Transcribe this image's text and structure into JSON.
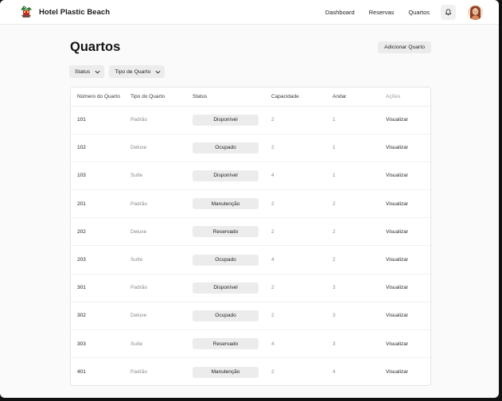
{
  "app": {
    "name": "Hotel Plastic Beach",
    "nav": [
      {
        "id": "dashboard",
        "label": "Dashboard"
      },
      {
        "id": "reservas",
        "label": "Reservas"
      },
      {
        "id": "quartos",
        "label": "Quartos"
      }
    ]
  },
  "page": {
    "title": "Quartos",
    "add_button": "Adicionar Quarto"
  },
  "filters": {
    "status": "Status",
    "room_type": "Tipo de Quarto"
  },
  "table": {
    "columns": [
      "Número do Quarto",
      "Tipo do Quarto",
      "Status",
      "Capacidade",
      "Andar",
      "Ações"
    ],
    "rows": [
      {
        "number": "101",
        "type": "Padrão",
        "status": "Disponível",
        "capacity": "2",
        "floor": "1",
        "action": "Visualizar"
      },
      {
        "number": "102",
        "type": "Deluxe",
        "status": "Ocupado",
        "capacity": "2",
        "floor": "1",
        "action": "Visualizar"
      },
      {
        "number": "103",
        "type": "Suíte",
        "status": "Disponível",
        "capacity": "4",
        "floor": "1",
        "action": "Visualizar"
      },
      {
        "number": "201",
        "type": "Padrão",
        "status": "Manutenção",
        "capacity": "2",
        "floor": "2",
        "action": "Visualizar"
      },
      {
        "number": "202",
        "type": "Deluxe",
        "status": "Reservado",
        "capacity": "2",
        "floor": "2",
        "action": "Visualizar"
      },
      {
        "number": "203",
        "type": "Suíte",
        "status": "Ocupado",
        "capacity": "4",
        "floor": "2",
        "action": "Visualizar"
      },
      {
        "number": "301",
        "type": "Padrão",
        "status": "Disponível",
        "capacity": "2",
        "floor": "3",
        "action": "Visualizar"
      },
      {
        "number": "302",
        "type": "Deluxe",
        "status": "Ocupado",
        "capacity": "2",
        "floor": "3",
        "action": "Visualizar"
      },
      {
        "number": "303",
        "type": "Suíte",
        "status": "Reservado",
        "capacity": "4",
        "floor": "3",
        "action": "Visualizar"
      },
      {
        "number": "401",
        "type": "Padrão",
        "status": "Manutenção",
        "capacity": "2",
        "floor": "4",
        "action": "Visualizar"
      }
    ]
  },
  "icons": {
    "logo": "hotel-logo-icon",
    "notifications": "bell-icon",
    "dropdown": "chevron-down-icon"
  },
  "colors": {
    "badge_bg": "#ececec",
    "page_bg": "#fafafa"
  }
}
